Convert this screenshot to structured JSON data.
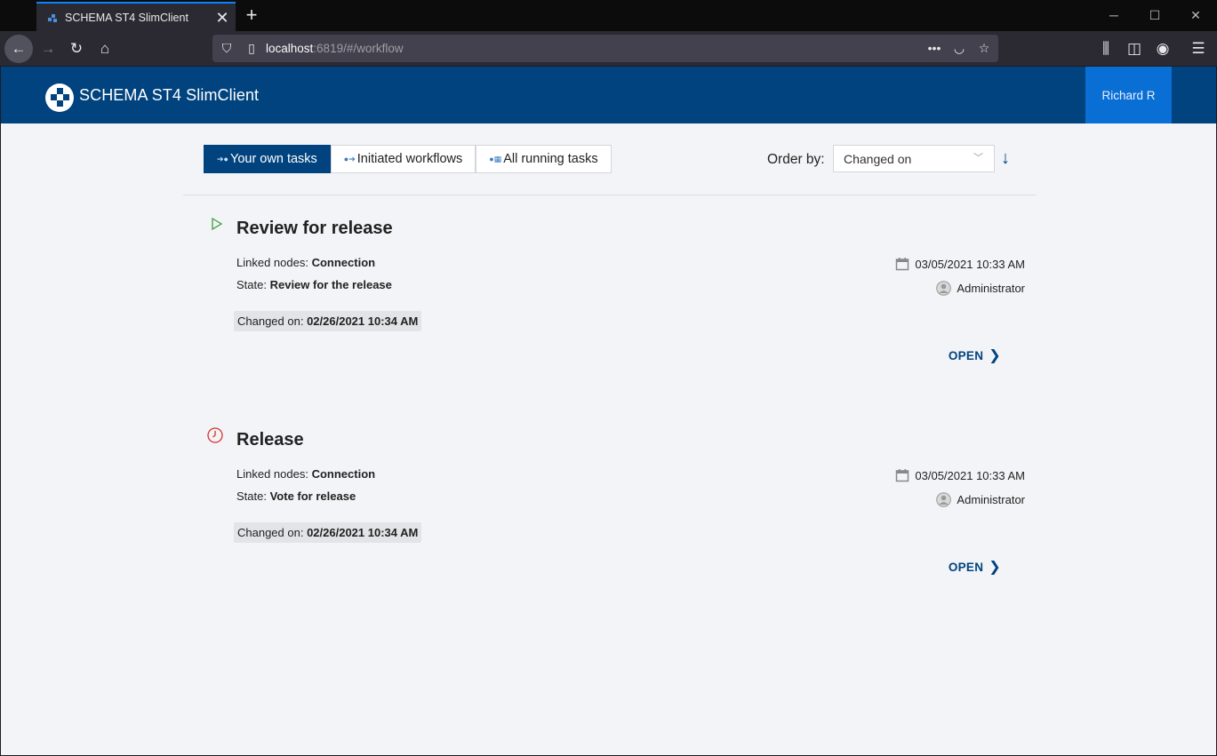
{
  "browser": {
    "tab_title": "SCHEMA ST4 SlimClient",
    "url_host": "localhost",
    "url_rest": ":6819/#/workflow"
  },
  "app": {
    "brand_bold": "SCHEMA ST4",
    "brand_light": "SlimClient",
    "user": "Richard R"
  },
  "tabs": [
    {
      "label": "Your own tasks",
      "active": true
    },
    {
      "label": "Initiated workflows",
      "active": false
    },
    {
      "label": "All running tasks",
      "active": false
    }
  ],
  "order": {
    "label": "Order by:",
    "value": "Changed on"
  },
  "labels": {
    "linked": "Linked nodes:",
    "state": "State:",
    "changed": "Changed on:",
    "open": "OPEN"
  },
  "tasks": [
    {
      "title": "Review for release",
      "status_icon": "play-icon",
      "linked_nodes": "Connection",
      "state": "Review for the release",
      "changed_on": "02/26/2021 10:34 AM",
      "date": "03/05/2021 10:33 AM",
      "user": "Administrator"
    },
    {
      "title": "Release",
      "status_icon": "clock-icon",
      "linked_nodes": "Connection",
      "state": "Vote for release",
      "changed_on": "02/26/2021 10:34 AM",
      "date": "03/05/2021 10:33 AM",
      "user": "Administrator"
    }
  ],
  "colors": {
    "primary": "#00437e",
    "user_bg": "#0a6fd4",
    "play": "#3aa13a",
    "clock": "#d9302c"
  }
}
